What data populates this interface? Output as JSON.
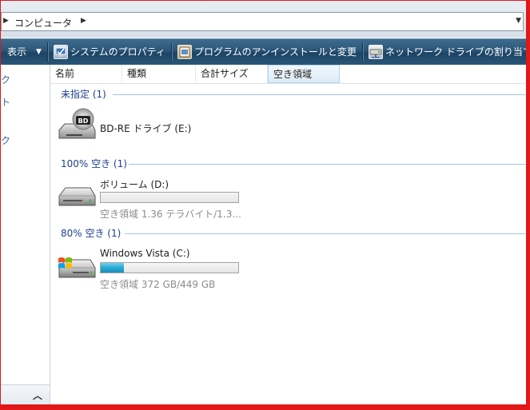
{
  "address": {
    "breadcrumb": "コンピュータ"
  },
  "toolbar": {
    "view_label": "表示",
    "system_properties_label": "システムのプロパティ",
    "uninstall_label": "プログラムのアンインストールと変更",
    "map_drive_label": "ネットワーク ドライブの割り当て"
  },
  "nav": {
    "fragments": [
      "ク",
      "ト",
      "ク"
    ]
  },
  "columns": {
    "name": "名前",
    "type": "種類",
    "total_size": "合計サイズ",
    "free_space": "空き領域"
  },
  "groups": [
    {
      "label": "未指定 (1)",
      "drives": [
        {
          "name": "BD-RE ドライブ (E:)",
          "icon": "bd-drive-icon"
        }
      ]
    },
    {
      "label": "100% 空き (1)",
      "drives": [
        {
          "name": "ボリューム (D:)",
          "used_fraction": 0.0,
          "free_text": "空き領域 1.36 テラバイト/1.3...",
          "icon": "hard-drive-icon"
        }
      ]
    },
    {
      "label": "80% 空き (1)",
      "drives": [
        {
          "name": "Windows Vista (C:)",
          "used_fraction": 0.17,
          "free_text": "空き領域 372 GB/449 GB",
          "icon": "windows-drive-icon"
        }
      ]
    }
  ],
  "colors": {
    "toolbar": "#2b5577",
    "group_text": "#1e3f8f",
    "bar_fill": "#27a9d4",
    "frame": "#e01818"
  }
}
